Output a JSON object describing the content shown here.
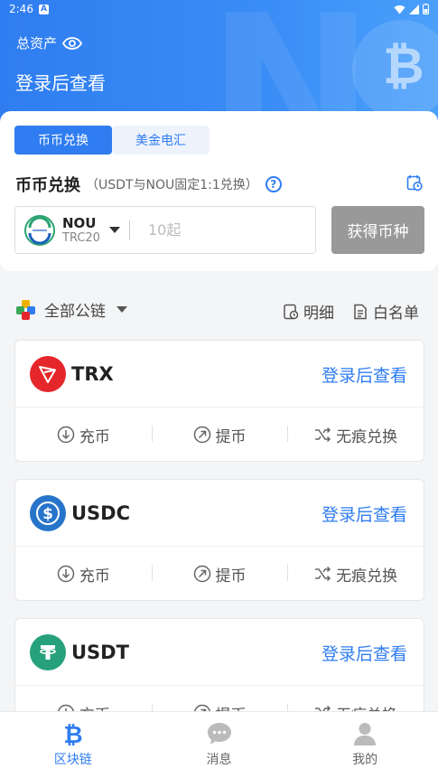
{
  "status_bar": {
    "time": "2:46",
    "notif": "A"
  },
  "header": {
    "total_assets_label": "总资产",
    "login_to_view": "登录后查看"
  },
  "exchange": {
    "tabs": [
      {
        "label": "币币兑换"
      },
      {
        "label": "美金电汇"
      }
    ],
    "title": "币币兑换",
    "note": "（USDT与NOU固定1:1兑换）",
    "help": "?",
    "coin": {
      "name": "NOU",
      "chain": "TRC20"
    },
    "amount_placeholder": "10起",
    "get_button": "获得币种"
  },
  "filter": {
    "chain_label": "全部公链",
    "detail_label": "明细",
    "whitelist_label": "白名单"
  },
  "assets": [
    {
      "name": "TRX",
      "login": "登录后查看",
      "color": "#e5262a"
    },
    {
      "name": "USDC",
      "login": "登录后查看",
      "color": "#2775ca"
    },
    {
      "name": "USDT",
      "login": "登录后查看",
      "color": "#26a17b"
    }
  ],
  "actions": {
    "deposit": "充币",
    "withdraw": "提币",
    "swap": "无痕兑换"
  },
  "nav": [
    {
      "label": "区块链",
      "icon": "bitcoin-icon",
      "active": true
    },
    {
      "label": "消息",
      "icon": "message-icon",
      "active": false
    },
    {
      "label": "我的",
      "icon": "user-icon",
      "active": false
    }
  ]
}
